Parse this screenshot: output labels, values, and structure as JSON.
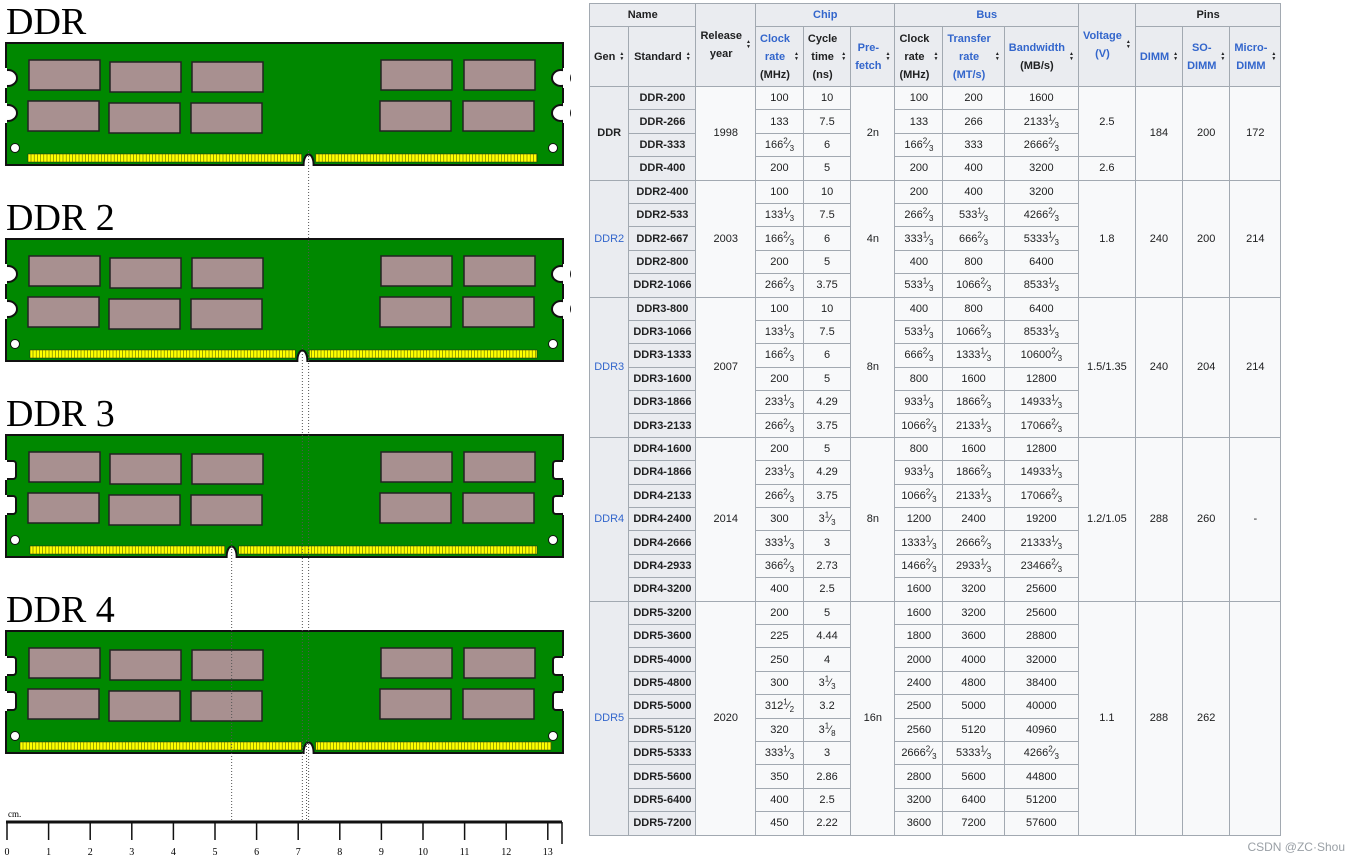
{
  "modules": [
    {
      "title": "DDR",
      "notch": "rounded-left",
      "key_cm": 7.25
    },
    {
      "title": "DDR 2",
      "notch": "rounded-left",
      "key_cm": 7.1
    },
    {
      "title": "DDR 3",
      "notch": "square-left",
      "key_cm": 5.4
    },
    {
      "title": "DDR 4",
      "notch": "square-left",
      "key_cm": 7.25
    }
  ],
  "ruler": {
    "unit": "cm.",
    "ticks": [
      "0",
      "1",
      "2",
      "3",
      "4",
      "5",
      "6",
      "7",
      "8",
      "9",
      "10",
      "11",
      "12",
      "13"
    ]
  },
  "table": {
    "group_headers": {
      "name": "Name",
      "chip": "Chip",
      "bus": "Bus",
      "pins": "Pins"
    },
    "columns": {
      "gen": "Gen",
      "standard": "Standard",
      "release_year": [
        "Release",
        "year"
      ],
      "chip_clock": [
        "Clock",
        "rate",
        "(MHz)"
      ],
      "cycle_time": [
        "Cycle",
        "time",
        "(ns)"
      ],
      "prefetch": [
        "Pre-",
        "fetch"
      ],
      "bus_clock": [
        "Clock",
        "rate",
        "(MHz)"
      ],
      "transfer_rate": [
        "Transfer",
        "rate",
        "(MT/s)"
      ],
      "bandwidth": [
        "Bandwidth",
        "(MB/s)"
      ],
      "voltage": [
        "Voltage",
        "(V)"
      ],
      "dimm": "DIMM",
      "sodimm": [
        "SO-",
        "DIMM"
      ],
      "microdimm": [
        "Micro-",
        "DIMM"
      ]
    },
    "sort_icon": "sort-arrows-icon",
    "generations": [
      {
        "gen": "DDR",
        "link": false,
        "year": "1998",
        "prefetch": "2n",
        "dimm": "184",
        "sodimm": "200",
        "microdimm": "172",
        "voltage_groups": [
          {
            "value": "2.5",
            "rows": 3
          },
          {
            "value": "2.6",
            "rows": 1
          }
        ],
        "rows": [
          [
            "DDR-200",
            "100",
            "10",
            "100",
            "200",
            "1600"
          ],
          [
            "DDR-266",
            "133",
            "7.5",
            "133",
            "266",
            "2133|1|3"
          ],
          [
            "DDR-333",
            "166|2|3",
            "6",
            "166|2|3",
            "333",
            "2666|2|3"
          ],
          [
            "DDR-400",
            "200",
            "5",
            "200",
            "400",
            "3200"
          ]
        ]
      },
      {
        "gen": "DDR2",
        "link": true,
        "year": "2003",
        "prefetch": "4n",
        "dimm": "240",
        "sodimm": "200",
        "microdimm": "214",
        "voltage_groups": [
          {
            "value": "1.8",
            "rows": 5
          }
        ],
        "rows": [
          [
            "DDR2-400",
            "100",
            "10",
            "200",
            "400",
            "3200"
          ],
          [
            "DDR2-533",
            "133|1|3",
            "7.5",
            "266|2|3",
            "533|1|3",
            "4266|2|3"
          ],
          [
            "DDR2-667",
            "166|2|3",
            "6",
            "333|1|3",
            "666|2|3",
            "5333|1|3"
          ],
          [
            "DDR2-800",
            "200",
            "5",
            "400",
            "800",
            "6400"
          ],
          [
            "DDR2-1066",
            "266|2|3",
            "3.75",
            "533|1|3",
            "1066|2|3",
            "8533|1|3"
          ]
        ]
      },
      {
        "gen": "DDR3",
        "link": true,
        "year": "2007",
        "prefetch": "8n",
        "dimm": "240",
        "sodimm": "204",
        "microdimm": "214",
        "voltage_groups": [
          {
            "value": "1.5/1.35",
            "rows": 6
          }
        ],
        "rows": [
          [
            "DDR3-800",
            "100",
            "10",
            "400",
            "800",
            "6400"
          ],
          [
            "DDR3-1066",
            "133|1|3",
            "7.5",
            "533|1|3",
            "1066|2|3",
            "8533|1|3"
          ],
          [
            "DDR3-1333",
            "166|2|3",
            "6",
            "666|2|3",
            "1333|1|3",
            "10600|2|3"
          ],
          [
            "DDR3-1600",
            "200",
            "5",
            "800",
            "1600",
            "12800"
          ],
          [
            "DDR3-1866",
            "233|1|3",
            "4.29",
            "933|1|3",
            "1866|2|3",
            "14933|1|3"
          ],
          [
            "DDR3-2133",
            "266|2|3",
            "3.75",
            "1066|2|3",
            "2133|1|3",
            "17066|2|3"
          ]
        ]
      },
      {
        "gen": "DDR4",
        "link": true,
        "year": "2014",
        "prefetch": "8n",
        "dimm": "288",
        "sodimm": "260",
        "microdimm": "-",
        "voltage_groups": [
          {
            "value": "1.2/1.05",
            "rows": 7
          }
        ],
        "rows": [
          [
            "DDR4-1600",
            "200",
            "5",
            "800",
            "1600",
            "12800"
          ],
          [
            "DDR4-1866",
            "233|1|3",
            "4.29",
            "933|1|3",
            "1866|2|3",
            "14933|1|3"
          ],
          [
            "DDR4-2133",
            "266|2|3",
            "3.75",
            "1066|2|3",
            "2133|1|3",
            "17066|2|3"
          ],
          [
            "DDR4-2400",
            "300",
            "3|1|3",
            "1200",
            "2400",
            "19200"
          ],
          [
            "DDR4-2666",
            "333|1|3",
            "3",
            "1333|1|3",
            "2666|2|3",
            "21333|1|3"
          ],
          [
            "DDR4-2933",
            "366|2|3",
            "2.73",
            "1466|2|3",
            "2933|1|3",
            "23466|2|3"
          ],
          [
            "DDR4-3200",
            "400",
            "2.5",
            "1600",
            "3200",
            "25600"
          ]
        ]
      },
      {
        "gen": "DDR5",
        "link": true,
        "year": "2020",
        "prefetch": "16n",
        "dimm": "288",
        "sodimm": "262",
        "microdimm": "",
        "voltage_groups": [
          {
            "value": "1.1",
            "rows": 10
          }
        ],
        "rows": [
          [
            "DDR5-3200",
            "200",
            "5",
            "1600",
            "3200",
            "25600"
          ],
          [
            "DDR5-3600",
            "225",
            "4.44",
            "1800",
            "3600",
            "28800"
          ],
          [
            "DDR5-4000",
            "250",
            "4",
            "2000",
            "4000",
            "32000"
          ],
          [
            "DDR5-4800",
            "300",
            "3|1|3",
            "2400",
            "4800",
            "38400"
          ],
          [
            "DDR5-5000",
            "312|1|2",
            "3.2",
            "2500",
            "5000",
            "40000"
          ],
          [
            "DDR5-5120",
            "320",
            "3|1|8",
            "2560",
            "5120",
            "40960"
          ],
          [
            "DDR5-5333",
            "333|1|3",
            "3",
            "2666|2|3",
            "5333|1|3",
            "4266|2|3"
          ],
          [
            "DDR5-5600",
            "350",
            "2.86",
            "2800",
            "5600",
            "44800"
          ],
          [
            "DDR5-6400",
            "400",
            "2.5",
            "3200",
            "6400",
            "51200"
          ],
          [
            "DDR5-7200",
            "450",
            "2.22",
            "3600",
            "7200",
            "57600"
          ]
        ]
      }
    ]
  },
  "watermark": "CSDN @ZC·Shou",
  "colors": {
    "pcb": "#008800",
    "chip": "#a89090",
    "contacts": "#ffff00",
    "link": "#3366cc",
    "header_bg": "#eaecf0",
    "cell_bg": "#f8f9fa",
    "border": "#a2a9b1"
  }
}
